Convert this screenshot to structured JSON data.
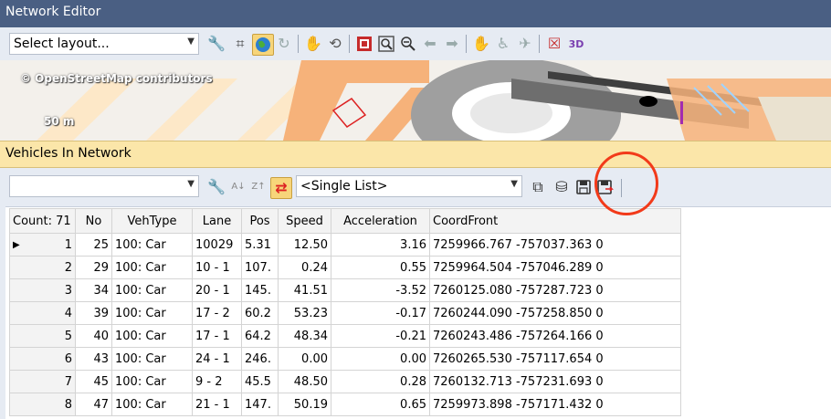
{
  "window": {
    "title": "Network Editor"
  },
  "toolbar1": {
    "layout_select": {
      "value": "Select layout..."
    },
    "icons": [
      "wrench-icon",
      "grid-icon",
      "globe-icon",
      "rotate-icon",
      "hand-pin-icon",
      "pointer-refresh-icon",
      "zoom-fit-icon",
      "zoom-window-icon",
      "zoom-out-icon",
      "back-arrow-icon",
      "forward-arrow-icon",
      "pan-hand-icon",
      "walk-icon",
      "plane-icon",
      "delete-view-icon",
      "3d-icon"
    ]
  },
  "map": {
    "credit": "© OpenStreetMap contributors",
    "scale": "50 m"
  },
  "panel": {
    "title": "Vehicles In Network"
  },
  "toolbar2": {
    "attribute_select": {
      "value": ""
    },
    "list_mode_select": {
      "value": "<Single List>"
    }
  },
  "colors": {
    "title_bar": "#4a5f83",
    "panel_header": "#fbe6a9",
    "highlight_circle": "#f23a1a"
  },
  "table": {
    "count_label": "Count: 71",
    "columns": [
      "No",
      "VehType",
      "Lane",
      "Pos",
      "Speed",
      "Acceleration",
      "CoordFront"
    ],
    "rows": [
      {
        "idx": "1",
        "no": "25",
        "vehtype": "100: Car",
        "lane": "10029",
        "pos": "5.31",
        "speed": "12.50",
        "accel": "3.16",
        "coord": "7259966.767 -757037.363 0"
      },
      {
        "idx": "2",
        "no": "29",
        "vehtype": "100: Car",
        "lane": "10 - 1",
        "pos": "107.",
        "speed": "0.24",
        "accel": "0.55",
        "coord": "7259964.504 -757046.289 0"
      },
      {
        "idx": "3",
        "no": "34",
        "vehtype": "100: Car",
        "lane": "20 - 1",
        "pos": "145.",
        "speed": "41.51",
        "accel": "-3.52",
        "coord": "7260125.080 -757287.723 0"
      },
      {
        "idx": "4",
        "no": "39",
        "vehtype": "100: Car",
        "lane": "17 - 2",
        "pos": "60.2",
        "speed": "53.23",
        "accel": "-0.17",
        "coord": "7260244.090 -757258.850 0"
      },
      {
        "idx": "5",
        "no": "40",
        "vehtype": "100: Car",
        "lane": "17 - 1",
        "pos": "64.2",
        "speed": "48.34",
        "accel": "-0.21",
        "coord": "7260243.486 -757264.166 0"
      },
      {
        "idx": "6",
        "no": "43",
        "vehtype": "100: Car",
        "lane": "24 - 1",
        "pos": "246.",
        "speed": "0.00",
        "accel": "0.00",
        "coord": "7260265.530 -757117.654 0"
      },
      {
        "idx": "7",
        "no": "45",
        "vehtype": "100: Car",
        "lane": "9 - 2",
        "pos": "45.5",
        "speed": "48.50",
        "accel": "0.28",
        "coord": "7260132.713 -757231.693 0"
      },
      {
        "idx": "8",
        "no": "47",
        "vehtype": "100: Car",
        "lane": "21 - 1",
        "pos": "147.",
        "speed": "50.19",
        "accel": "0.65",
        "coord": "7259973.898 -757171.432 0"
      }
    ]
  }
}
